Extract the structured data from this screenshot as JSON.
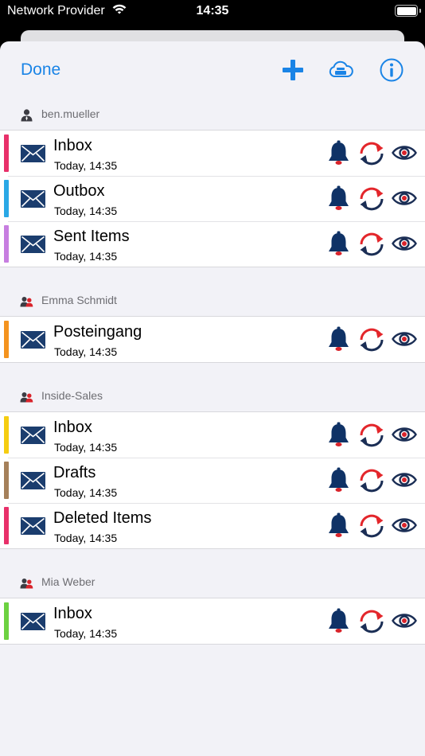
{
  "status_bar": {
    "carrier": "Network Provider",
    "time": "14:35",
    "wifi_icon": "wifi-icon",
    "battery_icon": "battery-icon"
  },
  "navbar": {
    "done_label": "Done",
    "icons": [
      "plus-icon",
      "cloud-server-icon",
      "info-icon"
    ],
    "accent_color": "#1a84e6"
  },
  "colors": {
    "mail_icon": "#1b3d6e",
    "bell": "#0f3266",
    "bell_clapper": "#d9232a",
    "sync_red": "#e3262b",
    "sync_dark": "#1b2e55",
    "eye": "#1b2e55",
    "eye_pupil": "#d9232a"
  },
  "sections": [
    {
      "header": "ben.mueller",
      "header_icon": "single-user-icon",
      "folders": [
        {
          "title": "Inbox",
          "subtitle": "Today, 14:35",
          "color": "#e8306a"
        },
        {
          "title": "Outbox",
          "subtitle": "Today, 14:35",
          "color": "#2aa8e6"
        },
        {
          "title": "Sent Items",
          "subtitle": "Today, 14:35",
          "color": "#c77ee0"
        }
      ]
    },
    {
      "header": "Emma Schmidt",
      "header_icon": "shared-users-icon",
      "folders": [
        {
          "title": "Posteingang",
          "subtitle": "Today, 14:35",
          "color": "#f4931f"
        }
      ]
    },
    {
      "header": "Inside-Sales",
      "header_icon": "shared-users-icon",
      "folders": [
        {
          "title": "Inbox",
          "subtitle": "Today, 14:35",
          "color": "#f5cd11"
        },
        {
          "title": "Drafts",
          "subtitle": "Today, 14:35",
          "color": "#a5805a"
        },
        {
          "title": "Deleted Items",
          "subtitle": "Today, 14:35",
          "color": "#e8306a"
        }
      ]
    },
    {
      "header": "Mia Weber",
      "header_icon": "shared-users-icon",
      "folders": [
        {
          "title": "Inbox",
          "subtitle": "Today, 14:35",
          "color": "#6cd140"
        }
      ]
    }
  ]
}
